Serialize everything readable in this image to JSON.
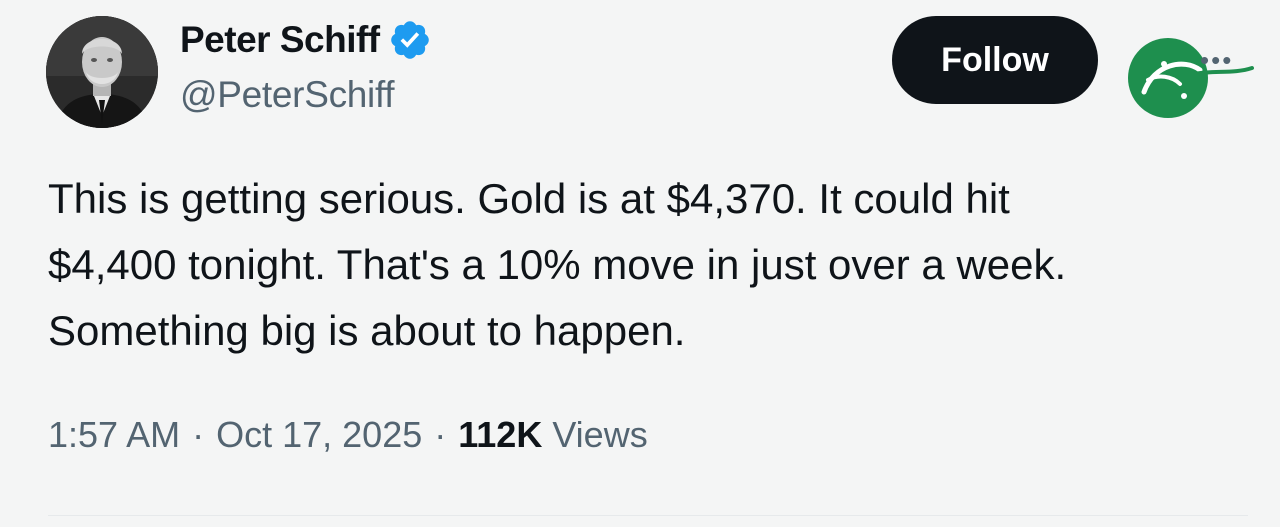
{
  "author": {
    "display_name": "Peter Schiff",
    "handle": "@PeterSchiff",
    "verified": true
  },
  "actions": {
    "follow_label": "Follow",
    "more_icon": "more-horizontal-icon"
  },
  "tweet": {
    "text": "This is getting serious. Gold is at $4,370. It could hit\n$4,400 tonight. That's a 10% move in just over a week.\nSomething big is about to happen."
  },
  "meta": {
    "time": "1:57 AM",
    "separator": "·",
    "date": "Oct 17, 2025",
    "views_count": "112K",
    "views_label": "Views"
  },
  "colors": {
    "text_primary": "#0f1419",
    "text_secondary": "#536471",
    "verified_blue": "#1d9bf0",
    "follow_bg": "#0f1419",
    "watermark_green": "#1e8f4e"
  }
}
